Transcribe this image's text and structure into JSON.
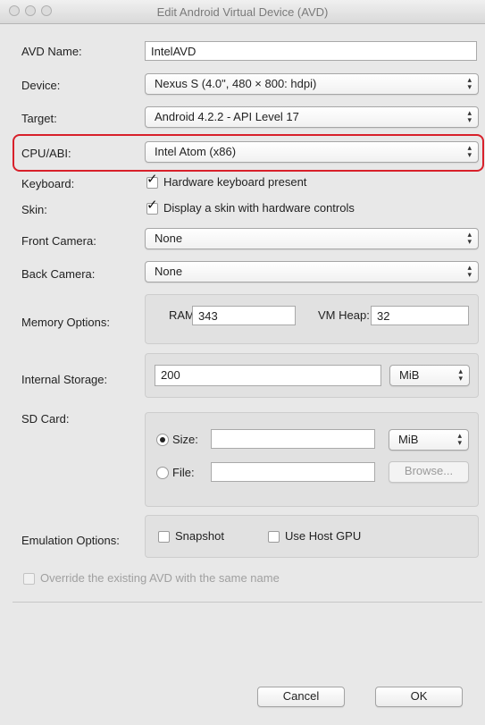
{
  "window": {
    "title": "Edit Android Virtual Device (AVD)"
  },
  "avd_name": {
    "label": "AVD Name:",
    "value": "IntelAVD"
  },
  "device": {
    "label": "Device:",
    "value": "Nexus S (4.0\", 480 × 800: hdpi)"
  },
  "target": {
    "label": "Target:",
    "value": "Android 4.2.2 - API Level 17"
  },
  "cpu_abi": {
    "label": "CPU/ABI:",
    "value": "Intel Atom (x86)",
    "highlight_color": "#d8202a"
  },
  "keyboard": {
    "label": "Keyboard:",
    "checkbox_label": "Hardware keyboard present",
    "checked": true
  },
  "skin": {
    "label": "Skin:",
    "checkbox_label": "Display a skin with hardware controls",
    "checked": true
  },
  "front_camera": {
    "label": "Front Camera:",
    "value": "None"
  },
  "back_camera": {
    "label": "Back Camera:",
    "value": "None"
  },
  "memory": {
    "label": "Memory Options:",
    "ram_label": "RAM:",
    "ram_value": "343",
    "vm_heap_label": "VM Heap:",
    "vm_heap_value": "32"
  },
  "internal_storage": {
    "label": "Internal Storage:",
    "value": "200",
    "unit": "MiB"
  },
  "sd_card": {
    "label": "SD Card:",
    "size_label": "Size:",
    "size_value": "",
    "size_unit": "MiB",
    "file_label": "File:",
    "file_value": "",
    "browse_label": "Browse..."
  },
  "emulation": {
    "label": "Emulation Options:",
    "snapshot_label": "Snapshot",
    "use_host_gpu_label": "Use Host GPU"
  },
  "override": {
    "label": "Override the existing AVD with the same name"
  },
  "buttons": {
    "cancel": "Cancel",
    "ok": "OK"
  }
}
